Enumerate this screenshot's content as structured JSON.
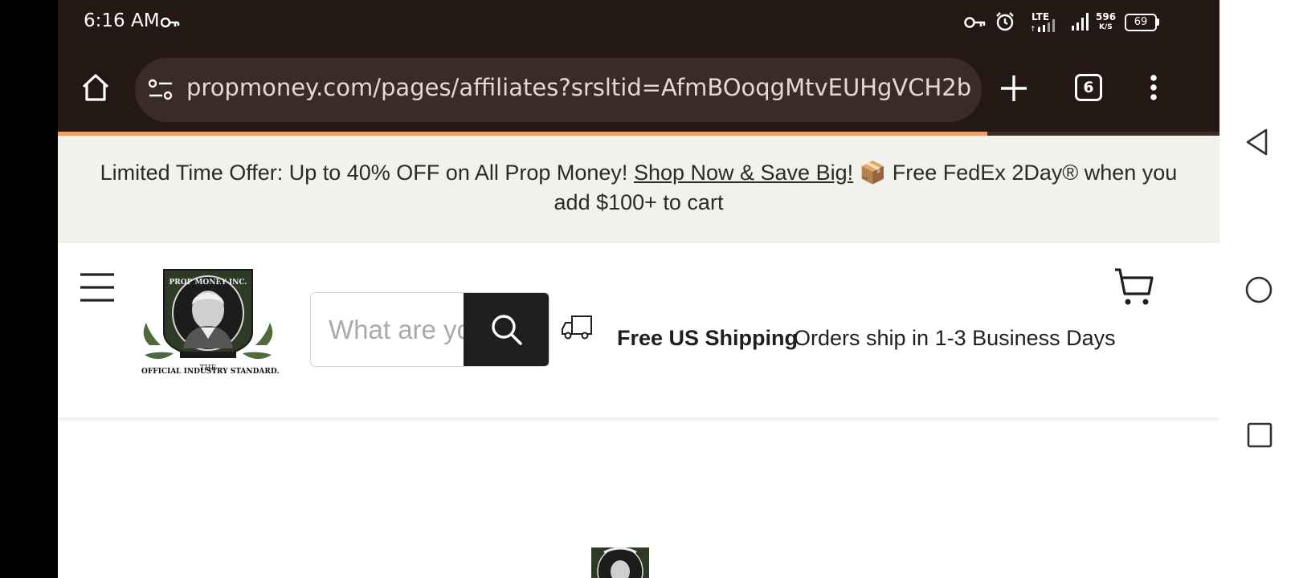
{
  "status_bar": {
    "time": "6:16 AM",
    "network": "LTE",
    "data_rate": "596",
    "data_rate_unit": "K/S",
    "battery": "69"
  },
  "browser": {
    "url": "propmoney.com/pages/affiliates?srsltid=AfmBOoqgMtvEUHgVCH2b",
    "tab_count": "6",
    "load_progress": 0.8
  },
  "promo": {
    "text": "Limited Time Offer: Up to 40% OFF on All Prop Money!",
    "link": "Shop Now & Save Big!",
    "emoji": "📦",
    "shipping": "Free FedEx 2Day® when you add $100+ to cart"
  },
  "header": {
    "logo_top_text": "PROP MONEY INC.",
    "logo_bottom_text": "THE",
    "logo_caption": "OFFICIAL INDUSTRY STANDARD.",
    "search_placeholder": "What are you looking for?",
    "shipping_title": "Free US Shipping",
    "shipping_text": "Orders ship in 1-3 Business Days"
  },
  "icons": {
    "home": "home-icon",
    "site_settings": "site-settings-icon",
    "new_tab": "plus-icon",
    "more": "more-vertical-icon",
    "menu": "hamburger-menu-icon",
    "search": "search-icon",
    "truck": "truck-icon",
    "cart": "cart-icon"
  },
  "colors": {
    "browser_bar": "#231813",
    "url_box": "#3a2c25",
    "progress": "#f0a06b",
    "promo_bg": "#f3f1ec",
    "search_button": "#1f1f1f"
  }
}
